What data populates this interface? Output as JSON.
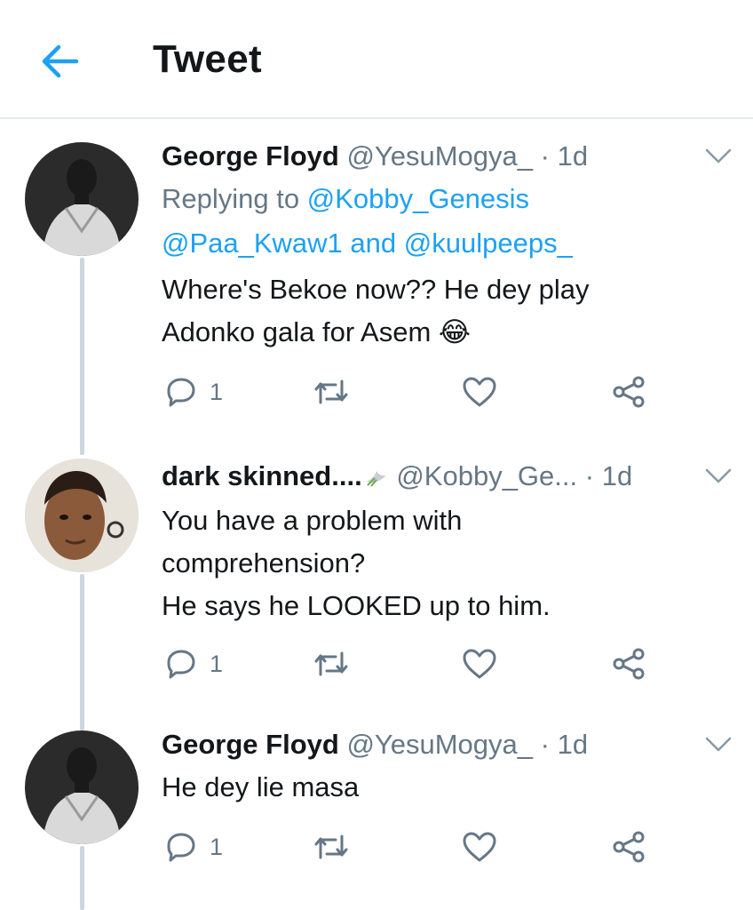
{
  "header": {
    "title": "Tweet"
  },
  "tweets": [
    {
      "name": "George Floyd",
      "handle": "@YesuMogya_",
      "dot": "·",
      "time": "1d",
      "replying_prefix": "Replying to ",
      "replying_user1": "@Kobby_Genesis",
      "replying_user2": "@Paa_Kwaw1",
      "replying_and": " and ",
      "replying_user3": "@kuulpeeps_",
      "text_line1": "Where's Bekoe now?? He dey play",
      "text_line2": "Adonko gala for Asem",
      "emoji": "😂",
      "reply_count": "1"
    },
    {
      "name": "dark skinned....",
      "name_icon": "dove-icon",
      "handle": "@Kobby_Ge...",
      "dot": "·",
      "time": "1d",
      "text_line1": "You have a problem with",
      "text_line2": "comprehension?",
      "text_line3": "He says he LOOKED up to him.",
      "reply_count": "1"
    },
    {
      "name": "George Floyd",
      "handle": "@YesuMogya_",
      "dot": "·",
      "time": "1d",
      "text_line1": "He dey lie masa",
      "reply_count": "1"
    }
  ],
  "colors": {
    "accent": "#1da1f2",
    "secondary_text": "#657786",
    "primary_text": "#14171a",
    "divider": "#e6ecf0",
    "thread_line": "#ccd6dd"
  }
}
